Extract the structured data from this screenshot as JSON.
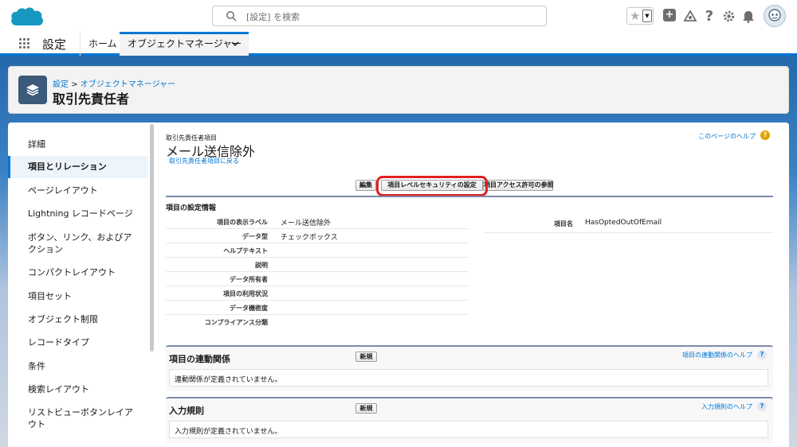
{
  "header": {
    "search_placeholder": "[設定] を検索",
    "icons": [
      "star-icon",
      "chevron-down-icon",
      "add-icon",
      "trailhead-icon",
      "help-icon",
      "gear-icon",
      "bell-icon",
      "avatar"
    ]
  },
  "nav": {
    "app_name": "設定",
    "tabs": [
      {
        "label": "ホーム"
      },
      {
        "label": "オブジェクトマネージャー",
        "active": true
      }
    ]
  },
  "page_header": {
    "breadcrumb": [
      "設定",
      "オブジェクトマネージャー"
    ],
    "breadcrumb_sep": ">",
    "title": "取引先責任者"
  },
  "sidebar": {
    "items": [
      {
        "label": "詳細"
      },
      {
        "label": "項目とリレーション",
        "active": true
      },
      {
        "label": "ページレイアウト"
      },
      {
        "label": "Lightning レコードページ"
      },
      {
        "label": "ボタン、リンク、およびアクション"
      },
      {
        "label": "コンパクトレイアウト"
      },
      {
        "label": "項目セット"
      },
      {
        "label": "オブジェクト制限"
      },
      {
        "label": "レコードタイプ"
      },
      {
        "label": "条件"
      },
      {
        "label": "検索レイアウト"
      },
      {
        "label": "リストビューボタンレイアウト"
      }
    ]
  },
  "detail": {
    "object_label": "取引先責任者項目",
    "field_title": "メール送信除外",
    "back_link": "取引先責任者項目に戻る",
    "help_link": "このページのヘルプ",
    "buttons": {
      "edit": "編集",
      "fls": "項目レベルセキュリティの設定",
      "access": "項目アクセス許可の参照"
    },
    "section_title": "項目の設定情報",
    "fields": [
      {
        "label": "項目の表示ラベル",
        "value": "メール送信除外"
      },
      {
        "label": "データ型",
        "value": "チェックボックス"
      },
      {
        "label": "ヘルプテキスト",
        "value": ""
      },
      {
        "label": "説明",
        "value": ""
      },
      {
        "label": "データ所有者",
        "value": ""
      },
      {
        "label": "項目の利用状況",
        "value": ""
      },
      {
        "label": "データ機密度",
        "value": ""
      },
      {
        "label": "コンプライアンス分類",
        "value": ""
      }
    ],
    "api_name_label": "項目名",
    "api_name_value": "HasOptedOutOfEmail"
  },
  "related_lists": [
    {
      "title": "項目の連動関係",
      "new_label": "新規",
      "help": "項目の連動関係のヘルプ",
      "empty": "連動関係が定義されていません。"
    },
    {
      "title": "入力規則",
      "new_label": "新規",
      "help": "入力規則のヘルプ",
      "empty": "入力規則が定義されていません。"
    }
  ],
  "colors": {
    "brand_blue": "#0176d3",
    "highlight_red": "#e02020"
  }
}
